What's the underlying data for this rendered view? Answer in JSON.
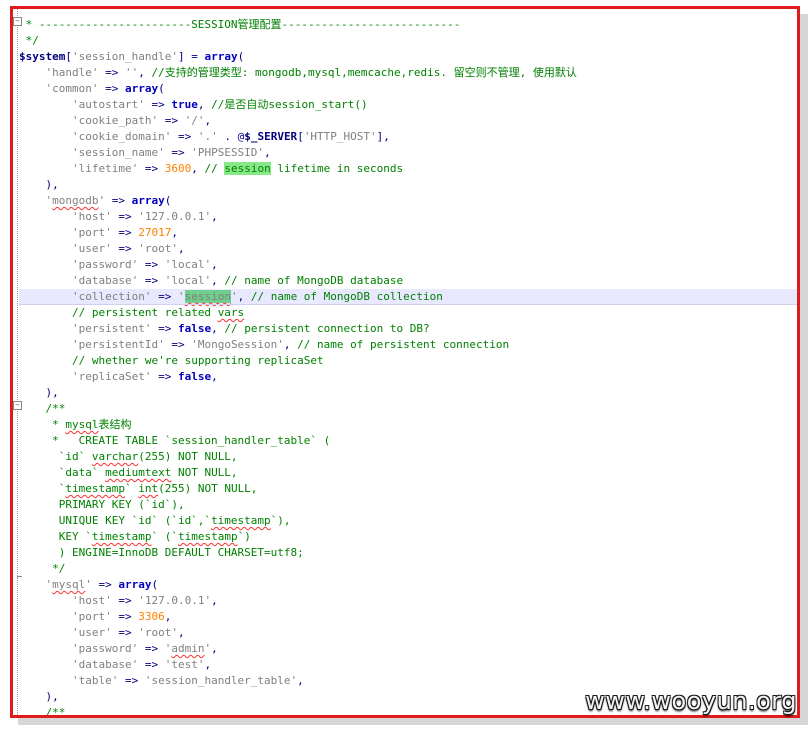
{
  "editor": {
    "lines": [
      {
        "id": "sep",
        "parts": [
          [
            "cm",
            " * -----------------------SESSION管理配置---------------------------"
          ]
        ]
      },
      {
        "id": "endcomment",
        "parts": [
          [
            "cm",
            " */"
          ]
        ]
      },
      {
        "id": "session-handle",
        "parts": [
          [
            "var",
            "$system"
          ],
          [
            "op",
            "["
          ],
          [
            "str",
            "'session_handle'"
          ],
          [
            "op",
            "] = "
          ],
          [
            "kw",
            "array"
          ],
          [
            "op",
            "("
          ]
        ]
      },
      {
        "id": "handle",
        "parts": [
          [
            "pl",
            "    "
          ],
          [
            "str",
            "'handle'"
          ],
          [
            "op",
            " => "
          ],
          [
            "str",
            "''"
          ],
          [
            "op",
            ", "
          ],
          [
            "cm",
            "//支持的管理类型: mongodb,mysql,memcache,redis. 留空则不管理, 使用默认"
          ]
        ]
      },
      {
        "id": "common",
        "parts": [
          [
            "pl",
            "    "
          ],
          [
            "str",
            "'common'"
          ],
          [
            "op",
            " => "
          ],
          [
            "kw",
            "array"
          ],
          [
            "op",
            "("
          ]
        ]
      },
      {
        "id": "autostart",
        "parts": [
          [
            "pl",
            "        "
          ],
          [
            "str",
            "'autostart'"
          ],
          [
            "op",
            " => "
          ],
          [
            "kw",
            "true"
          ],
          [
            "op",
            ", "
          ],
          [
            "cm",
            "//是否自动session_start()"
          ]
        ]
      },
      {
        "id": "cookie-path",
        "parts": [
          [
            "pl",
            "        "
          ],
          [
            "str",
            "'cookie_path'"
          ],
          [
            "op",
            " => "
          ],
          [
            "str",
            "'/'"
          ],
          [
            "op",
            ","
          ]
        ]
      },
      {
        "id": "cookie-domain",
        "parts": [
          [
            "pl",
            "        "
          ],
          [
            "str",
            "'cookie_domain'"
          ],
          [
            "op",
            " => "
          ],
          [
            "str",
            "'.'"
          ],
          [
            "op",
            " . @"
          ],
          [
            "var",
            "$_SERVER"
          ],
          [
            "op",
            "["
          ],
          [
            "str",
            "'HTTP_HOST'"
          ],
          [
            "op",
            "],"
          ]
        ]
      },
      {
        "id": "session-name",
        "parts": [
          [
            "pl",
            "        "
          ],
          [
            "str",
            "'session_name'"
          ],
          [
            "op",
            " => "
          ],
          [
            "str",
            "'PHPSESSID'"
          ],
          [
            "op",
            ","
          ]
        ]
      },
      {
        "id": "lifetime",
        "parts": [
          [
            "pl",
            "        "
          ],
          [
            "str",
            "'lifetime'"
          ],
          [
            "op",
            " => "
          ],
          [
            "num",
            "3600"
          ],
          [
            "op",
            ", "
          ],
          [
            "cm",
            "// "
          ],
          [
            "cmhl",
            "session"
          ],
          [
            "cm",
            " lifetime in seconds"
          ]
        ]
      },
      {
        "id": "common-close",
        "parts": [
          [
            "pl",
            "    "
          ],
          [
            "op",
            "),"
          ]
        ]
      },
      {
        "id": "mongodb",
        "parts": [
          [
            "pl",
            "    "
          ],
          [
            "str",
            "'"
          ],
          [
            "strsq",
            "mongodb"
          ],
          [
            "str",
            "'"
          ],
          [
            "op",
            " => "
          ],
          [
            "kw",
            "array"
          ],
          [
            "op",
            "("
          ]
        ]
      },
      {
        "id": "m-host",
        "parts": [
          [
            "pl",
            "        "
          ],
          [
            "str",
            "'host'"
          ],
          [
            "op",
            " => "
          ],
          [
            "str",
            "'127.0.0.1'"
          ],
          [
            "op",
            ","
          ]
        ]
      },
      {
        "id": "m-port",
        "parts": [
          [
            "pl",
            "        "
          ],
          [
            "str",
            "'port'"
          ],
          [
            "op",
            " => "
          ],
          [
            "num",
            "27017"
          ],
          [
            "op",
            ","
          ]
        ]
      },
      {
        "id": "m-user",
        "parts": [
          [
            "pl",
            "        "
          ],
          [
            "str",
            "'user'"
          ],
          [
            "op",
            " => "
          ],
          [
            "str",
            "'root'"
          ],
          [
            "op",
            ","
          ]
        ]
      },
      {
        "id": "m-password",
        "parts": [
          [
            "pl",
            "        "
          ],
          [
            "str",
            "'password'"
          ],
          [
            "op",
            " => "
          ],
          [
            "str",
            "'local'"
          ],
          [
            "op",
            ","
          ]
        ]
      },
      {
        "id": "m-database",
        "parts": [
          [
            "pl",
            "        "
          ],
          [
            "str",
            "'database'"
          ],
          [
            "op",
            " => "
          ],
          [
            "str",
            "'local'"
          ],
          [
            "op",
            ", "
          ],
          [
            "cm",
            "// name of MongoDB database"
          ]
        ]
      },
      {
        "id": "m-collection",
        "current": true,
        "parts": [
          [
            "pl",
            "        "
          ],
          [
            "str",
            "'collection'"
          ],
          [
            "op",
            " => "
          ],
          [
            "str",
            "'"
          ],
          [
            "strsel",
            "session"
          ],
          [
            "str",
            "'"
          ],
          [
            "op",
            ", "
          ],
          [
            "cm",
            "// name of MongoDB collection"
          ]
        ]
      },
      {
        "id": "m-c1",
        "parts": [
          [
            "pl",
            "        "
          ],
          [
            "cm",
            "// persistent related "
          ],
          [
            "cmsq",
            "vars"
          ]
        ]
      },
      {
        "id": "m-persistent",
        "parts": [
          [
            "pl",
            "        "
          ],
          [
            "str",
            "'persistent'"
          ],
          [
            "op",
            " => "
          ],
          [
            "kw",
            "false"
          ],
          [
            "op",
            ", "
          ],
          [
            "cm",
            "// persistent connection to DB?"
          ]
        ]
      },
      {
        "id": "m-persistentid",
        "parts": [
          [
            "pl",
            "        "
          ],
          [
            "str",
            "'persistentId'"
          ],
          [
            "op",
            " => "
          ],
          [
            "str",
            "'MongoSession'"
          ],
          [
            "op",
            ", "
          ],
          [
            "cm",
            "// name of persistent connection"
          ]
        ]
      },
      {
        "id": "m-c2",
        "parts": [
          [
            "pl",
            "        "
          ],
          [
            "cm",
            "// whether we're supporting replicaSet"
          ]
        ]
      },
      {
        "id": "m-replicaset",
        "parts": [
          [
            "pl",
            "        "
          ],
          [
            "str",
            "'replicaSet'"
          ],
          [
            "op",
            " => "
          ],
          [
            "kw",
            "false"
          ],
          [
            "op",
            ","
          ]
        ]
      },
      {
        "id": "mongodb-close",
        "parts": [
          [
            "pl",
            "    "
          ],
          [
            "op",
            "),"
          ]
        ]
      },
      {
        "id": "doc-open",
        "parts": [
          [
            "pl",
            "    "
          ],
          [
            "cm",
            "/**"
          ]
        ]
      },
      {
        "id": "doc-title",
        "parts": [
          [
            "cm",
            "     * "
          ],
          [
            "cmsq",
            "mysql"
          ],
          [
            "cm",
            "表结构"
          ]
        ]
      },
      {
        "id": "doc-create",
        "parts": [
          [
            "cm",
            "     *   CREATE TABLE `session_handler_table` ("
          ]
        ]
      },
      {
        "id": "doc-id",
        "parts": [
          [
            "cm",
            "      `id` "
          ],
          [
            "cmsq",
            "varchar"
          ],
          [
            "cm",
            "(255) NOT NULL,"
          ]
        ]
      },
      {
        "id": "doc-data",
        "parts": [
          [
            "cm",
            "      `data` "
          ],
          [
            "cmsq",
            "mediumtext"
          ],
          [
            "cm",
            " NOT NULL,"
          ]
        ]
      },
      {
        "id": "doc-ts",
        "parts": [
          [
            "cm",
            "      `"
          ],
          [
            "cmsq",
            "timestamp"
          ],
          [
            "cm",
            "` "
          ],
          [
            "cmsq",
            "int"
          ],
          [
            "cm",
            "(255) NOT NULL,"
          ]
        ]
      },
      {
        "id": "doc-pk",
        "parts": [
          [
            "cm",
            "      PRIMARY KEY (`id`),"
          ]
        ]
      },
      {
        "id": "doc-uk",
        "parts": [
          [
            "cm",
            "      UNIQUE KEY `id` (`id`,`"
          ],
          [
            "cmsq",
            "timestamp"
          ],
          [
            "cm",
            "`),"
          ]
        ]
      },
      {
        "id": "doc-key",
        "parts": [
          [
            "cm",
            "      KEY `"
          ],
          [
            "cmsq",
            "timestamp"
          ],
          [
            "cm",
            "` (`"
          ],
          [
            "cmsq",
            "timestamp"
          ],
          [
            "cm",
            "`)"
          ]
        ]
      },
      {
        "id": "doc-engine",
        "parts": [
          [
            "cm",
            "      ) ENGINE=InnoDB DEFAULT CHARSET=utf8;"
          ]
        ]
      },
      {
        "id": "doc-close",
        "parts": [
          [
            "cm",
            "     */"
          ]
        ]
      },
      {
        "id": "mysql",
        "parts": [
          [
            "pl",
            "    "
          ],
          [
            "str",
            "'"
          ],
          [
            "strsq",
            "mysql"
          ],
          [
            "str",
            "'"
          ],
          [
            "op",
            " => "
          ],
          [
            "kw",
            "array"
          ],
          [
            "op",
            "("
          ]
        ]
      },
      {
        "id": "y-host",
        "parts": [
          [
            "pl",
            "        "
          ],
          [
            "str",
            "'host'"
          ],
          [
            "op",
            " => "
          ],
          [
            "str",
            "'127.0.0.1'"
          ],
          [
            "op",
            ","
          ]
        ]
      },
      {
        "id": "y-port",
        "parts": [
          [
            "pl",
            "        "
          ],
          [
            "str",
            "'port'"
          ],
          [
            "op",
            " => "
          ],
          [
            "num",
            "3306"
          ],
          [
            "op",
            ","
          ]
        ]
      },
      {
        "id": "y-user",
        "parts": [
          [
            "pl",
            "        "
          ],
          [
            "str",
            "'user'"
          ],
          [
            "op",
            " => "
          ],
          [
            "str",
            "'root'"
          ],
          [
            "op",
            ","
          ]
        ]
      },
      {
        "id": "y-password",
        "parts": [
          [
            "pl",
            "        "
          ],
          [
            "str",
            "'password'"
          ],
          [
            "op",
            " => "
          ],
          [
            "str",
            "'"
          ],
          [
            "strsq",
            "admin"
          ],
          [
            "str",
            "'"
          ],
          [
            "op",
            ","
          ]
        ]
      },
      {
        "id": "y-database",
        "parts": [
          [
            "pl",
            "        "
          ],
          [
            "str",
            "'database'"
          ],
          [
            "op",
            " => "
          ],
          [
            "str",
            "'test'"
          ],
          [
            "op",
            ","
          ]
        ]
      },
      {
        "id": "y-table",
        "parts": [
          [
            "pl",
            "        "
          ],
          [
            "str",
            "'table'"
          ],
          [
            "op",
            " => "
          ],
          [
            "str",
            "'session_handler_table'"
          ],
          [
            "op",
            ","
          ]
        ]
      },
      {
        "id": "mysql-close",
        "parts": [
          [
            "pl",
            "    "
          ],
          [
            "op",
            "),"
          ]
        ]
      },
      {
        "id": "doc2-open",
        "parts": [
          [
            "pl",
            "    "
          ],
          [
            "cm",
            "/**"
          ]
        ]
      }
    ]
  },
  "watermark": "www.wooyun.org",
  "colors": {
    "frame_border": "#e01b1b",
    "comment": "#008000",
    "string": "#808080",
    "keyword": "#0000c0",
    "number": "#ff8000",
    "highlight": "#86e886",
    "current_line": "#e8e8ff"
  }
}
